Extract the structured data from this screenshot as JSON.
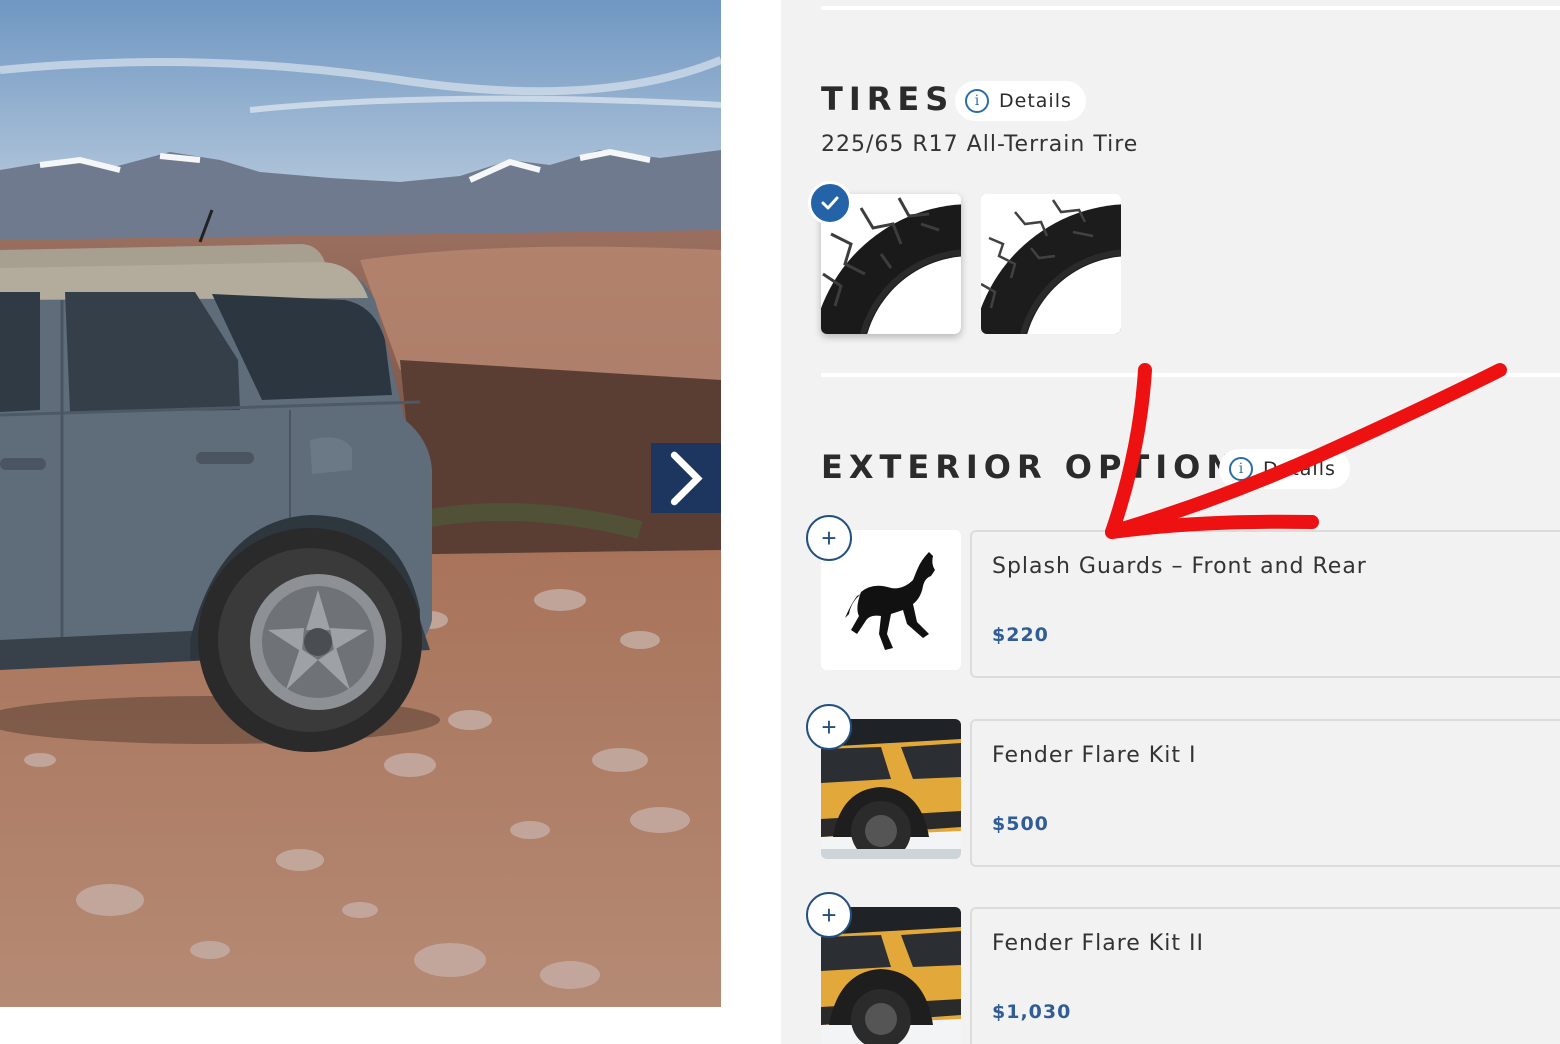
{
  "hero": {
    "next_icon": "chevron-right-icon"
  },
  "tires": {
    "title": "TIRES",
    "details_label": "Details",
    "spec": "225/65 R17 All-Terrain Tire",
    "selected_index": 0
  },
  "exterior": {
    "title": "EXTERIOR OPTIONS",
    "details_label": "Details",
    "options": [
      {
        "name": "Splash Guards – Front and Rear",
        "price": "$220",
        "thumb": "bronco-horse-logo"
      },
      {
        "name": "Fender Flare Kit I",
        "price": "$500",
        "thumb": "yellow-bronco-photo"
      },
      {
        "name": "Fender Flare Kit II",
        "price": "$1,030",
        "thumb": "yellow-bronco-photo"
      }
    ]
  },
  "colors": {
    "accent": "#2563a8",
    "price": "#2f5d94",
    "nav_button": "#1c3660",
    "annotation": "#ee1111"
  }
}
